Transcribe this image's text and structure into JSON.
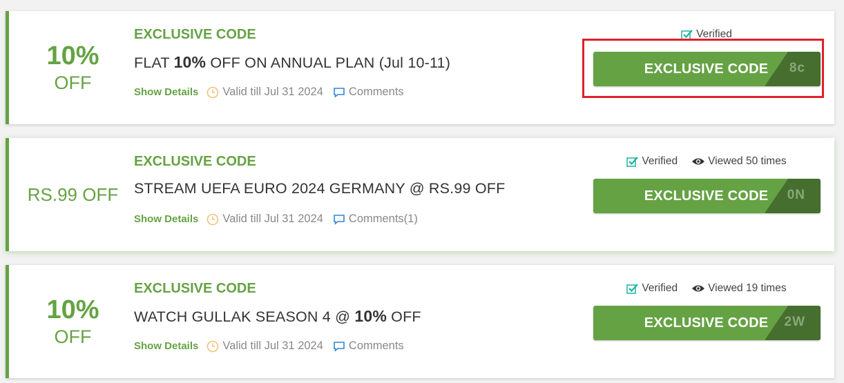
{
  "accent_color": "#65a244",
  "highlight_color": "#e0202a",
  "coupons": [
    {
      "discount_top": "10%",
      "discount_bottom": "OFF",
      "type": "EXCLUSIVE CODE",
      "title_pre": "FLAT ",
      "title_bold": "10%",
      "title_post": " OFF ON ANNUAL PLAN (Jul 10-11)",
      "show_details": "Show Details",
      "valid": "Valid till Jul 31 2024",
      "comments": "Comments",
      "verified": "Verified",
      "views": "",
      "button": "EXCLUSIVE CODE",
      "code_peek": "8c",
      "highlighted": true
    },
    {
      "discount_single": "RS.99 OFF",
      "type": "EXCLUSIVE CODE",
      "title": "STREAM UEFA EURO 2024 GERMANY @ RS.99 OFF",
      "show_details": "Show Details",
      "valid": "Valid till Jul 31 2024",
      "comments": "Comments(1)",
      "verified": "Verified",
      "views": "Viewed 50 times",
      "button": "EXCLUSIVE CODE",
      "code_peek": "0N"
    },
    {
      "discount_top": "10%",
      "discount_bottom": "OFF",
      "type": "EXCLUSIVE CODE",
      "title_pre": "WATCH GULLAK SEASON 4 @ ",
      "title_bold": "10%",
      "title_post": " OFF",
      "show_details": "Show Details",
      "valid": "Valid till Jul 31 2024",
      "comments": "Comments",
      "verified": "Verified",
      "views": "Viewed 19 times",
      "button": "EXCLUSIVE CODE",
      "code_peek": "2W"
    }
  ],
  "icons": {
    "clock": "clock-icon",
    "comment": "comment-icon",
    "verified": "verified-check-icon",
    "eye": "eye-icon"
  }
}
